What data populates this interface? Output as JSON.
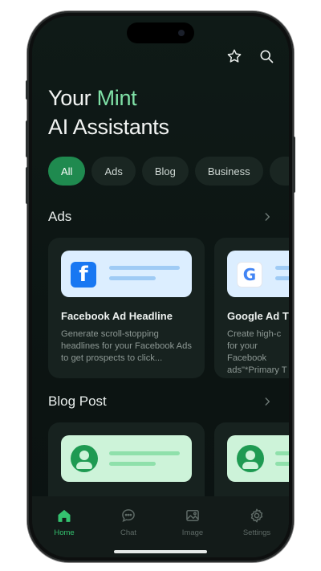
{
  "header": {
    "title_prefix": "Your ",
    "title_accent": "Mint",
    "title_line2": "AI Assistants",
    "icons": [
      "star-icon",
      "search-icon"
    ]
  },
  "filters": {
    "chips": [
      "All",
      "Ads",
      "Blog",
      "Business"
    ],
    "active": "All"
  },
  "sections": [
    {
      "title": "Ads",
      "cards": [
        {
          "icon": "facebook-logo",
          "logo_text": "f",
          "title": "Facebook Ad Headline",
          "description": "Generate scroll-stopping headlines for your Facebook Ads to get prospects to click..."
        },
        {
          "icon": "google-logo",
          "logo_text": "G",
          "title": "Google Ad T",
          "description": "Create high-c for your Facebook ads\"*Primary T"
        }
      ]
    },
    {
      "title": "Blog Post",
      "cards": [
        {
          "icon": "user-avatar-icon"
        },
        {
          "icon": "user-avatar-icon"
        }
      ]
    }
  ],
  "tabbar": {
    "items": [
      {
        "label": "Home",
        "icon": "home-icon",
        "active": true
      },
      {
        "label": "Chat",
        "icon": "chat-icon",
        "active": false
      },
      {
        "label": "Image",
        "icon": "image-icon",
        "active": false
      },
      {
        "label": "Settings",
        "icon": "settings-icon",
        "active": false
      }
    ]
  },
  "colors": {
    "accent": "#7fe0a6",
    "active_chip": "#1f8a4f",
    "active_tab": "#34c26f",
    "facebook": "#1877f2"
  }
}
